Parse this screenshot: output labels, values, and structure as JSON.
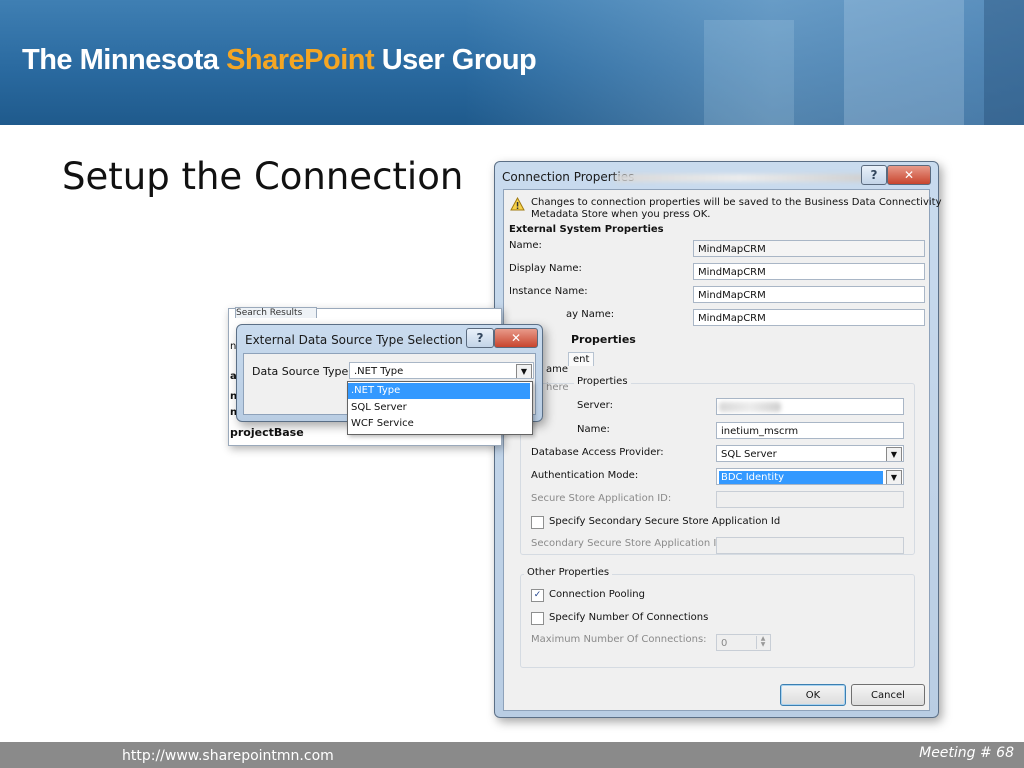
{
  "banner": {
    "title_pre": "The Minnesota ",
    "title_accent": "SharePoint",
    "title_post": " User Group"
  },
  "slide": {
    "title": "Setup the Connection"
  },
  "footer": {
    "url": "http://www.sharepointmn.com",
    "meeting": "Meeting # 68"
  },
  "connection_dialog": {
    "title": "Connection Properties",
    "notice": [
      "Changes to connection properties will be saved to the Business Data Connectivity",
      "Metadata Store when you press OK."
    ],
    "section_external": "External System Properties",
    "name_label": "Name:",
    "name_value": "MindMapCRM",
    "display_name_label": "Display Name:",
    "display_name_value": "MindMapCRM",
    "instance_name_label": "Instance Name:",
    "instance_name_value": "MindMapCRM",
    "partial_display_label": "ay Name:",
    "partial_display_value": "MindMapCRM",
    "partial_section": "Properties",
    "partial_tab": "ent",
    "partial_label_me": "ame",
    "partial_label_here": "here",
    "connection_group_legend": "Properties",
    "server_label": "Server:",
    "db_name_label": "Name:",
    "db_name_value": "inetium_mscrm",
    "provider_label": "Database Access Provider:",
    "provider_value": "SQL Server",
    "auth_label": "Authentication Mode:",
    "auth_value": "BDC Identity",
    "secure_store_label": "Secure Store Application ID:",
    "secondary_check_label": "Specify Secondary Secure Store Application Id",
    "secondary_id_label": "Secondary Secure Store Application ID:",
    "other_legend": "Other Properties",
    "pooling_label": "Connection Pooling",
    "pooling_checked": "✓",
    "specify_number_label": "Specify Number Of Connections",
    "max_label": "Maximum Number Of Connections:",
    "max_value": "0",
    "ok_label": "OK",
    "cancel_label": "Cancel",
    "help_glyph": "?",
    "close_glyph": "✕"
  },
  "type_dialog": {
    "title": "External Data Source Type Selection",
    "behind_title": "Search Results",
    "data_source_label": "Data Source Type",
    "selected": ".NET Type",
    "options": [
      ".NET Type",
      "SQL Server",
      "WCF Service"
    ],
    "behind_list_item": "projectBase",
    "behind_fragments": [
      "n",
      "ad",
      "ne",
      "n"
    ],
    "help_glyph": "?",
    "close_glyph": "✕",
    "arrow_glyph": "▼"
  },
  "colors": {
    "accent": "#f5a623",
    "selection": "#3399ff",
    "window_frame": "#b9cde3"
  }
}
